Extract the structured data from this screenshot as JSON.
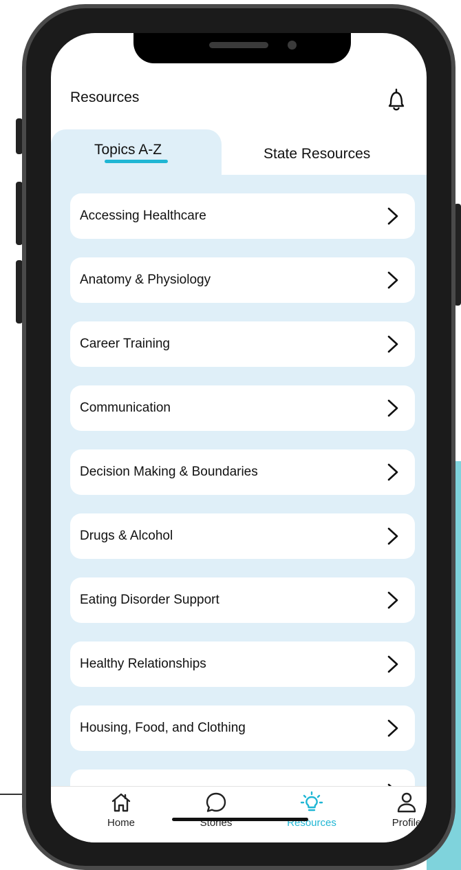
{
  "header": {
    "title": "Resources",
    "bell_icon": "bell-icon"
  },
  "tabs": [
    {
      "label": "Topics A-Z",
      "active": true
    },
    {
      "label": "State Resources",
      "active": false
    }
  ],
  "topics": [
    {
      "label": "Accessing Healthcare"
    },
    {
      "label": "Anatomy & Physiology"
    },
    {
      "label": "Career Training"
    },
    {
      "label": "Communication"
    },
    {
      "label": "Decision Making & Boundaries"
    },
    {
      "label": "Drugs & Alcohol"
    },
    {
      "label": "Eating Disorder Support"
    },
    {
      "label": "Healthy Relationships"
    },
    {
      "label": "Housing, Food, and Clothing"
    }
  ],
  "bottom_nav": [
    {
      "label": "Home",
      "icon": "home-icon",
      "active": false
    },
    {
      "label": "Stories",
      "icon": "chat-bubble-icon",
      "active": false
    },
    {
      "label": "Resources",
      "icon": "lightbulb-icon",
      "active": true
    },
    {
      "label": "Profile",
      "icon": "profile-icon",
      "active": false
    }
  ],
  "colors": {
    "accent": "#1fb6d4",
    "panel_bg": "#dfeff8",
    "card_bg": "#ffffff",
    "text": "#111111"
  }
}
